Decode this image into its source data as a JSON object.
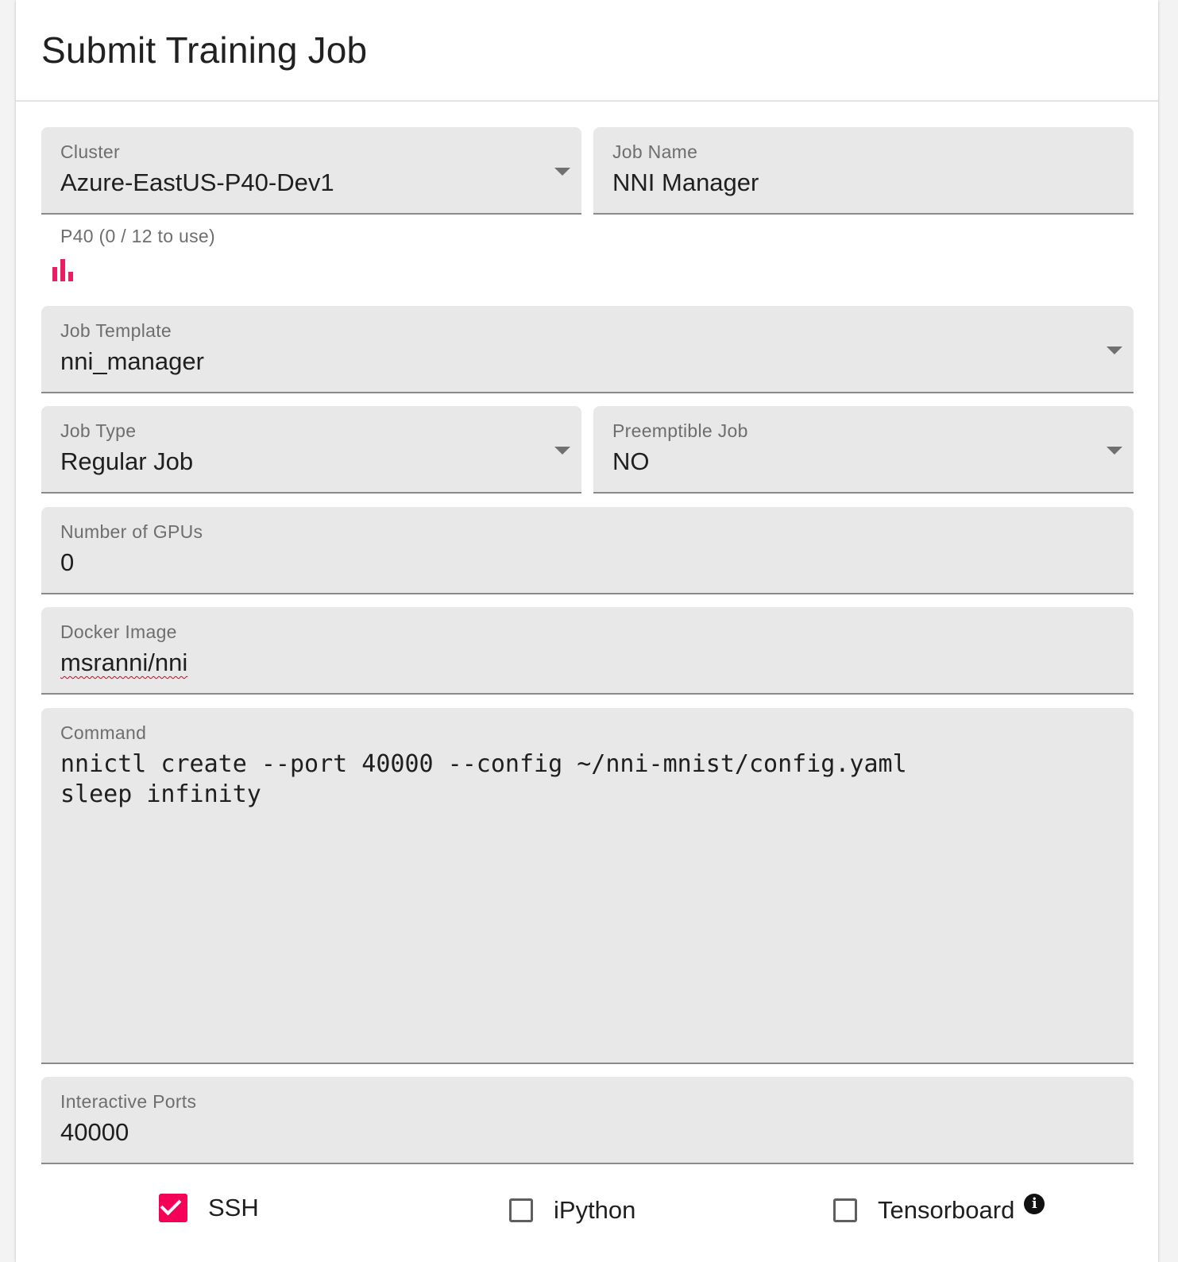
{
  "card": {
    "title": "Submit Training Job"
  },
  "cluster": {
    "label": "Cluster",
    "value": "Azure-EastUS-P40-Dev1",
    "helper": "P40 (0 / 12 to use)",
    "icon": "bar-chart-icon"
  },
  "job_name": {
    "label": "Job Name",
    "value": "NNI Manager"
  },
  "job_template": {
    "label": "Job Template",
    "value": "nni_manager"
  },
  "job_type": {
    "label": "Job Type",
    "value": "Regular Job"
  },
  "preemptible": {
    "label": "Preemptible Job",
    "value": "NO"
  },
  "gpus": {
    "label": "Number of GPUs",
    "value": "0"
  },
  "docker_image": {
    "label": "Docker Image",
    "value": "msranni/nni"
  },
  "command": {
    "label": "Command",
    "value": "nnictl create --port 40000 --config ~/nni-mnist/config.yaml\nsleep infinity"
  },
  "interactive_ports": {
    "label": "Interactive Ports",
    "value": "40000"
  },
  "options": {
    "ssh": {
      "label": "SSH",
      "checked": true
    },
    "ipython": {
      "label": "iPython",
      "checked": false
    },
    "tensorboard": {
      "label": "Tensorboard",
      "checked": false,
      "info_icon": "info-icon"
    }
  },
  "colors": {
    "accent": "#f50057",
    "field_bg": "#e8e8e8",
    "spellcheck": "#e0001b"
  }
}
